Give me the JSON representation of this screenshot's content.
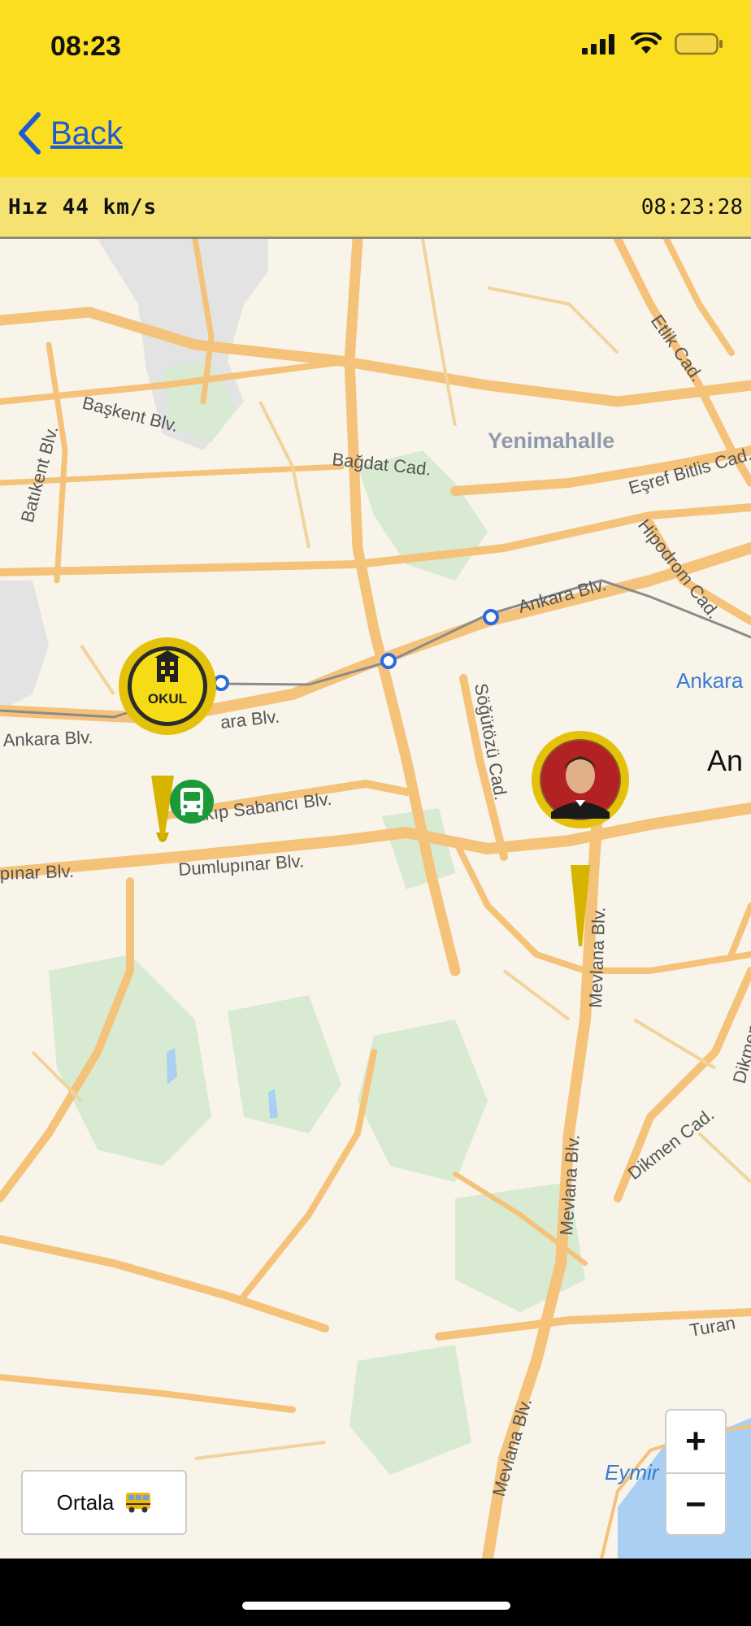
{
  "status_bar": {
    "time": "08:23",
    "icons": [
      "cellular-signal-icon",
      "wifi-icon",
      "battery-icon"
    ]
  },
  "nav": {
    "back_label": "Back"
  },
  "info_bar": {
    "speed": "Hız 44 km/s",
    "clock": "08:23:28"
  },
  "map": {
    "districts": [
      "Yenimahalle"
    ],
    "city_label": "Ankara",
    "city_partial": "An",
    "partial_label": "Eymir",
    "roads": {
      "baskent": "Başkent Blv.",
      "batikent": "Batıkent Blv.",
      "bagdat": "Bağdat Cad.",
      "etlik": "Etlik Cad.",
      "esref": "Eşref Bitlis Cad.",
      "hipodrom": "Hipodrom Cad.",
      "ankara_blv_1": "Ankara Blv.",
      "ankara_blv_2": "Ankara Blv.",
      "ankara_blv_3": "ara Blv.",
      "sogutozu": "Söğütözü Cad.",
      "sakip": "Sakıp Sabancı Blv.",
      "dumlupinar_1": "Dumlupınar Blv.",
      "dumlupinar_2": "pınar Blv.",
      "mevlana_1": "Mevlana Blv.",
      "mevlana_2": "Mevlana Blv.",
      "mevlana_3": "Mevlana Blv.",
      "dikmen_1": "Dikmen Cad.",
      "dikmen_2": "Dikmen",
      "turan": "Turan"
    },
    "markers": {
      "school_label": "OKUL",
      "school_icon": "school-building-icon",
      "bus_icon": "bus-icon",
      "student_icon": "student-avatar"
    }
  },
  "zoom": {
    "in_label": "+",
    "out_label": "−"
  },
  "center_button": {
    "label": "Ortala",
    "icon": "school-bus-icon"
  },
  "colors": {
    "brand_yellow": "#fbde20",
    "info_bar": "#f6e270",
    "link_blue": "#1d5bd6",
    "road": "#f5c27a",
    "map_bg": "#f8f4ea"
  }
}
